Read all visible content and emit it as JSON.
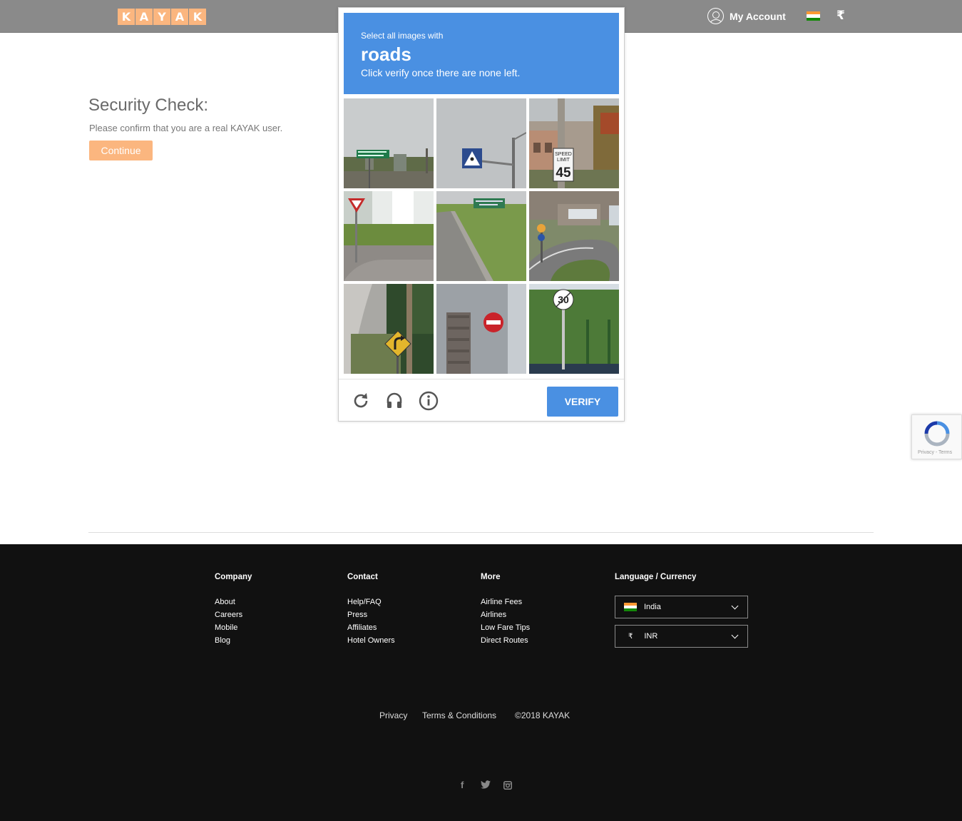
{
  "header": {
    "logo_letters": [
      "K",
      "A",
      "Y",
      "A",
      "K"
    ],
    "account_label": "My Account",
    "currency_symbol": "₹"
  },
  "security": {
    "title": "Security Check:",
    "message": "Please confirm that you are a real KAYAK user.",
    "continue_label": "Continue"
  },
  "captcha": {
    "instruction": "Select all images with",
    "target": "roads",
    "hint": "Click verify once there are none left.",
    "verify_label": "VERIFY",
    "tiles": [
      {
        "name": "tile-street-sign-green",
        "text": ""
      },
      {
        "name": "tile-pedestrian-crossing-sign",
        "text": ""
      },
      {
        "name": "tile-speed-limit-45",
        "text": "45"
      },
      {
        "name": "tile-yield-sign",
        "text": ""
      },
      {
        "name": "tile-road-with-green-sign",
        "text": ""
      },
      {
        "name": "tile-roundabout",
        "text": ""
      },
      {
        "name": "tile-curve-warning-sign",
        "text": ""
      },
      {
        "name": "tile-no-entry-sign",
        "text": ""
      },
      {
        "name": "tile-speed-30-sign",
        "text": "30"
      }
    ],
    "tile_sign_texts": [
      "SPEED",
      "LIMIT"
    ],
    "footer_icons": [
      "reload-icon",
      "audio-icon",
      "info-icon"
    ],
    "accent_color": "#4a90e2"
  },
  "recaptcha_badge": {
    "text": "Privacy - Terms"
  },
  "footer": {
    "company": {
      "heading": "Company",
      "links": [
        "About",
        "Careers",
        "Mobile",
        "Blog"
      ]
    },
    "contact": {
      "heading": "Contact",
      "links": [
        "Help/FAQ",
        "Press",
        "Affiliates",
        "Hotel Owners"
      ]
    },
    "more": {
      "heading": "More",
      "links": [
        "Airline Fees",
        "Airlines",
        "Low Fare Tips",
        "Direct Routes"
      ]
    },
    "lang": {
      "heading": "Language / Currency",
      "country": "India",
      "currency_symbol": "₹",
      "currency": "INR"
    },
    "legal": {
      "privacy": "Privacy",
      "terms": "Terms & Conditions",
      "copyright": "©2018 KAYAK"
    },
    "social": {
      "facebook": "f",
      "twitter": "twitter-icon",
      "instagram": "instagram-icon"
    }
  },
  "colors": {
    "brand_orange": "#fbb67f",
    "header_gray": "#8a8a8a",
    "footer_bg": "#111111"
  }
}
